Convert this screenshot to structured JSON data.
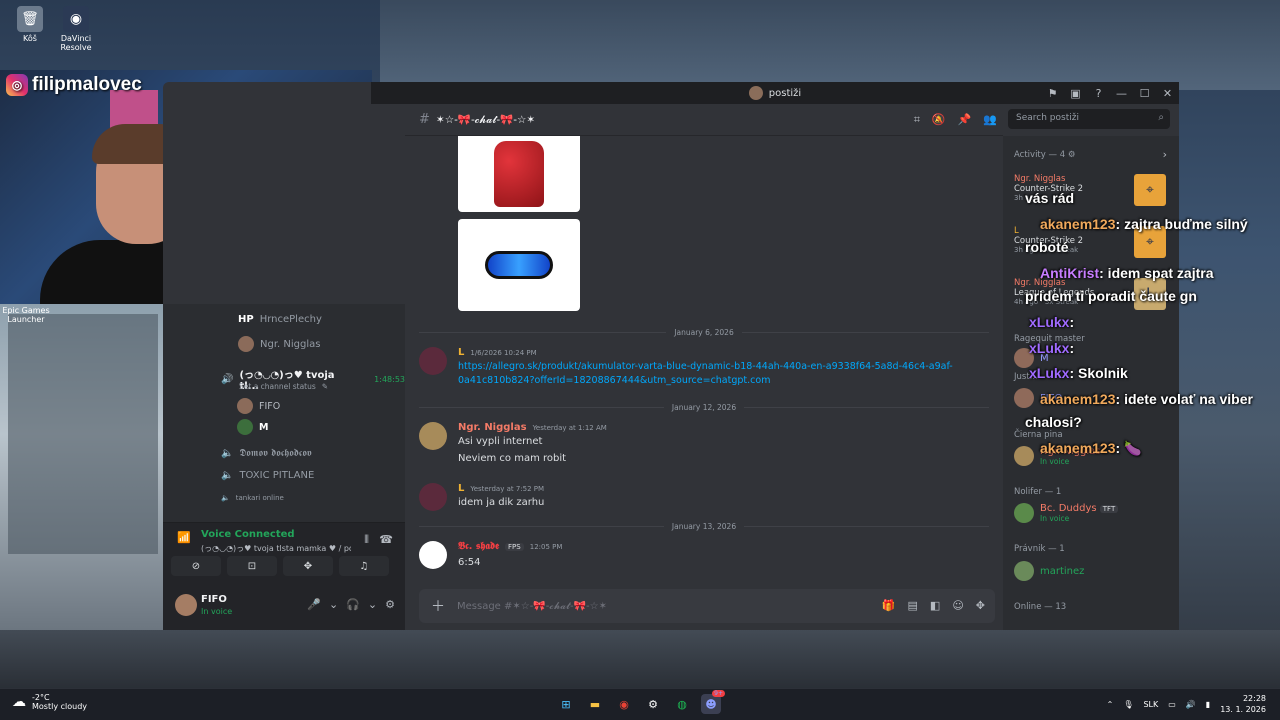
{
  "desktop": {
    "icons": [
      {
        "label": "Kôš",
        "icon": "recycle-bin-icon"
      },
      {
        "label": "DaVinci Resolve",
        "icon": "davinci-icon"
      },
      {
        "label": "Epic Games Launcher",
        "icon": "epic-games-icon"
      }
    ]
  },
  "stream": {
    "instagram_handle": "filipmalovec"
  },
  "window": {
    "title": "postiži"
  },
  "channels": {
    "rows": [
      {
        "prefix": "HP",
        "name": "HrncePlechy"
      },
      {
        "name": "Ngr. Nigglas"
      }
    ],
    "active_voice": {
      "name": "(っ◔◡◔)っ♥ tvoja tl...",
      "timer": "1:48:53",
      "status": "Set a channel status",
      "members": [
        "FIFO",
        "M"
      ]
    },
    "other": [
      "𝕯𝖔𝖒𝖔𝖛 𝖉𝖔𝖈𝖍𝖔𝖉𝖈𝖔𝖛",
      "TOXIC PITLANE",
      "tankari online"
    ]
  },
  "voice_bar": {
    "title": "Voice Connected",
    "subtitle": "(っ◔◡◔)っ♥ tvoja tlsta mamka ♥ / po..."
  },
  "user": {
    "name": "FIFO",
    "status": "In voice"
  },
  "chat": {
    "channel_name": "✶☆-🎀-𝓬𝓱𝓪𝓽-🎀-☆✶",
    "search_placeholder": "Search postiži",
    "composer_placeholder": "Message #✶☆-🎀-𝓬𝓱𝓪𝓽-🎀-☆✶",
    "dividers": [
      "January 6, 2026",
      "January 12, 2026",
      "January 13, 2026"
    ],
    "messages": [
      {
        "author": "L",
        "author_color": "#f0b232",
        "time": "1/6/2026 10:24 PM",
        "lines": [
          "https://allegro.sk/produkt/akumulator-varta-blue-dynamic-b18-44ah-440a-en-a9338f64-5a8d-46c4-a9af-",
          "0a41c810b824?offerId=18208867444&utm_source=chatgpt.com"
        ]
      },
      {
        "author": "Ngr. Nigglas",
        "author_color": "#f47b67",
        "time": "Yesterday at 1:12 AM",
        "lines": [
          "Asi vypli internet",
          "Neviem co mam robit"
        ]
      },
      {
        "author": "L",
        "author_color": "#f0b232",
        "time": "Yesterday at 7:52 PM",
        "lines": [
          "idem ja dik zarhu"
        ]
      },
      {
        "author": "𝕭𝖈. 𝖘𝖍𝖆𝖉𝖊",
        "author_color": "#f23f43",
        "tag": "FPS",
        "time": "12:05 PM",
        "lines": [
          "6:54"
        ]
      }
    ]
  },
  "members": {
    "activity_header": "Activity — 4",
    "activity": [
      {
        "name": "Ngr. Nigglas",
        "detail": "Counter-Strike 2",
        "time": "3h ago"
      },
      {
        "name": "L",
        "detail": "Counter-Strike 2",
        "time": "3h ago",
        "streak": "4x Streak"
      },
      {
        "name": "Ngr. Nigglas",
        "detail": "League of Legends",
        "time": "4h ago",
        "streak": "3x Streak"
      }
    ],
    "groups": [
      {
        "header": "Ragequit master",
        "members": [
          {
            "name": "M",
            "status": ""
          }
        ]
      },
      {
        "header": "Just...",
        "members": [
          {
            "name": "FIFO",
            "status": ""
          }
        ]
      },
      {
        "header": "Čierna pina",
        "members": [
          {
            "name": "Ngr. Nigglas",
            "status": "In voice",
            "color": "#f47b67"
          }
        ]
      },
      {
        "header": "Nolifer — 1",
        "members": [
          {
            "name": "Bc. Duddys",
            "tag": "TFT",
            "status": "In voice",
            "color": "#f47b67"
          }
        ]
      },
      {
        "header": "Právnik — 1",
        "members": [
          {
            "name": "martinez",
            "status": "",
            "color": "#23a55a"
          }
        ]
      },
      {
        "header": "Online — 13",
        "members": []
      }
    ]
  },
  "overlay_chat": [
    {
      "user": "",
      "text": "vás rád",
      "user_color": "#ffffff"
    },
    {
      "user": "akanem123",
      "text": ": zajtra buďme silný",
      "user_color": "#f0a95c"
    },
    {
      "user": "",
      "text": "roboté",
      "user_color": "#ffffff"
    },
    {
      "user": "AntiKrist",
      "text": ": idem spat zajtra",
      "user_color": "#c77dff"
    },
    {
      "user": "",
      "text": "pridem ti poradit čaute gn",
      "user_color": "#ffffff"
    },
    {
      "user": "xLukx",
      "text": ":",
      "user_color": "#a06bff"
    },
    {
      "user": "xLukx",
      "text": ":",
      "user_color": "#a06bff"
    },
    {
      "user": "xLukx",
      "text": ": Skolnik",
      "user_color": "#a06bff"
    },
    {
      "user": "akanem123",
      "text": ": idete volať na viber",
      "user_color": "#f0a95c"
    },
    {
      "user": "",
      "text": "chalosi?",
      "user_color": "#ffffff"
    },
    {
      "user": "akanem123",
      "text": ": 🍆",
      "user_color": "#f0a95c"
    }
  ],
  "taskbar": {
    "temperature": "-2°C",
    "weather": "Mostly cloudy",
    "language": "SLK",
    "time": "22:28",
    "date": "13. 1. 2026",
    "discord_badge": "9+"
  },
  "colors": {
    "discord_bg": "#313338",
    "accent_green": "#23a55a",
    "link": "#00a8fc"
  }
}
